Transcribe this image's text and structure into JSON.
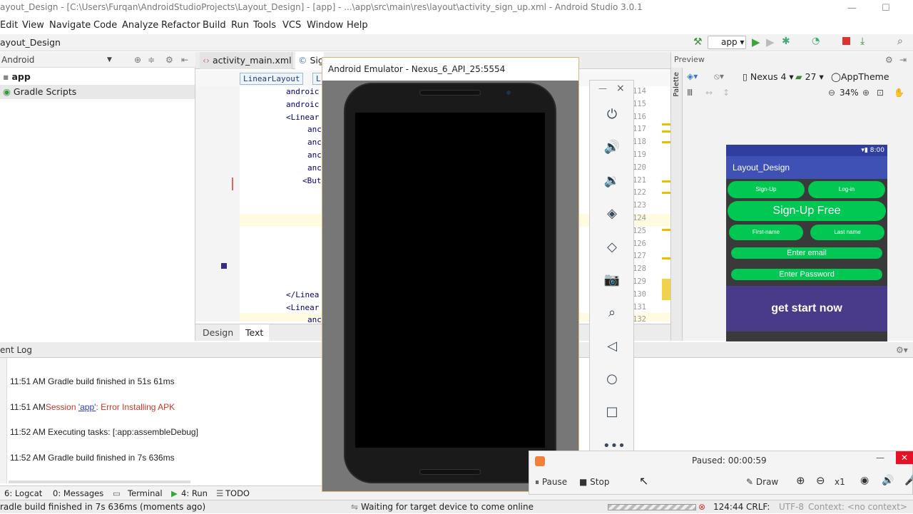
{
  "window": {
    "title": "ayout_Design - [C:\\Users\\Furqan\\AndroidStudioProjects\\Layout_Design] - [app] - ...\\app\\src\\main\\res\\layout\\activity_sign_up.xml - Android Studio 3.0.1"
  },
  "menu": [
    "Edit",
    "View",
    "Navigate",
    "Code",
    "Analyze",
    "Refactor",
    "Build",
    "Run",
    "Tools",
    "VCS",
    "Window",
    "Help"
  ],
  "toolbar": {
    "breadcrumb": "ayout_Design",
    "run_config": "app"
  },
  "project": {
    "view_mode": "Android",
    "items": [
      "app",
      "Gradle Scripts"
    ]
  },
  "editor": {
    "tabs": [
      "activity_main.xml",
      "Sig"
    ],
    "breadcrumbs": [
      "LinearLayout",
      "L"
    ],
    "line_numbers": [
      "114",
      "115",
      "116",
      "117",
      "118",
      "119",
      "120",
      "121",
      "122",
      "123",
      "124",
      "125",
      "126",
      "127",
      "128",
      "129",
      "130",
      "131",
      "132"
    ],
    "code_lines": [
      "androic",
      "androic",
      "<Linear",
      "anc",
      "anc",
      "anc",
      "anc",
      "<But",
      "",
      "",
      "",
      "",
      "",
      "",
      "",
      "",
      "</Linea",
      "<Linear",
      "anc"
    ],
    "bottom_tabs": [
      "Design",
      "Text"
    ]
  },
  "preview": {
    "label": "Preview",
    "palette_label": "Palette",
    "device": "Nexus 4",
    "api": "27",
    "theme": "AppTheme",
    "zoom": "34%",
    "phone": {
      "time": "8:00",
      "app_title": "Layout_Design",
      "btn_signup": "Sign-Up",
      "btn_login": "Log-in",
      "btn_signup_free": "Sign-Up Free",
      "btn_first": "First-name",
      "btn_last": "Last name",
      "btn_email": "Enter email",
      "btn_password": "Enter Password",
      "btn_start": "get start now"
    }
  },
  "event_log": {
    "title": "ent Log",
    "entries": [
      {
        "time": "11:51 AM",
        "text": "Gradle build finished in 51s 61ms"
      },
      {
        "time": "11:51 AM",
        "text_pre": "Session ",
        "link": "'app'",
        "text_post": ": Error Installing APK"
      },
      {
        "time": "11:52 AM",
        "text": "Executing tasks: [:app:assembleDebug]"
      },
      {
        "time": "11:52 AM",
        "text": "Gradle build finished in 7s 636ms"
      }
    ]
  },
  "toolstrip": {
    "logcat": "6: Logcat",
    "messages": "0: Messages",
    "terminal": "Terminal",
    "run": "4: Run",
    "todo": "TODO"
  },
  "status": {
    "left": "radle build finished in 7s 636ms (moments ago)",
    "center": "Waiting for target device to come online",
    "position": "124:44",
    "line_sep": "CRLF:",
    "encoding": "UTF-8",
    "context": "Context: <no context>"
  },
  "emulator": {
    "title": "Android Emulator - Nexus_6_API_25:5554"
  },
  "recorder": {
    "status": "Paused: 00:00:59",
    "pause": "Pause",
    "stop": "Stop",
    "draw": "Draw",
    "zoom_level": "x1"
  }
}
